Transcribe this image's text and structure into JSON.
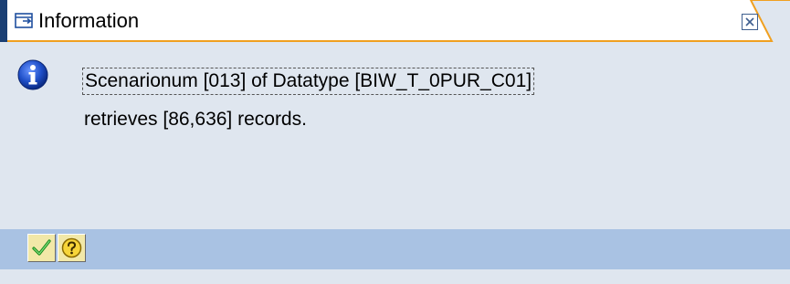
{
  "dialog": {
    "title": "Information",
    "message_line1": "Scenarionum [013] of Datatype [BIW_T_0PUR_C01]",
    "message_line2": "retrieves [86,636] records."
  },
  "icons": {
    "title": "dialog-window-icon",
    "close": "close-icon",
    "message": "info-icon",
    "confirm": "checkmark-icon",
    "help": "help-icon"
  },
  "colors": {
    "title_accent": "#f0a020",
    "title_strip": "#1a3f73",
    "body_bg": "#dfe6ef",
    "footer_bg": "#a9c2e3",
    "info_icon": "#1f4fc8"
  }
}
